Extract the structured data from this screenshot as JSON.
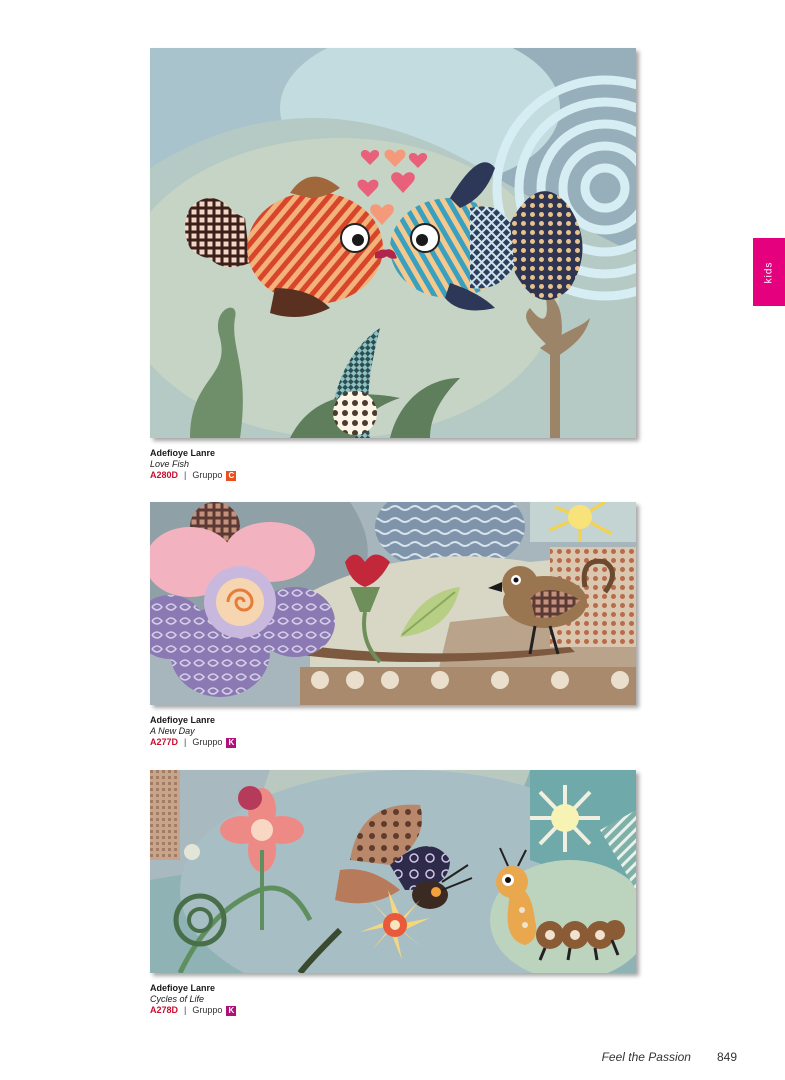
{
  "side_tab": {
    "label": "kids",
    "color": "#e5007e"
  },
  "products": [
    {
      "artist": "Adefioye Lanre",
      "title": "Love Fish",
      "code": "A280D",
      "group_label": "Gruppo",
      "group": "C",
      "group_color": "#e8501e"
    },
    {
      "artist": "Adefioye Lanre",
      "title": "A New Day",
      "code": "A277D",
      "group_label": "Gruppo",
      "group": "K",
      "group_color": "#b0107a"
    },
    {
      "artist": "Adefioye Lanre",
      "title": "Cycles of Life",
      "code": "A278D",
      "group_label": "Gruppo",
      "group": "K",
      "group_color": "#b0107a"
    }
  ],
  "footer": {
    "tagline": "Feel the Passion",
    "page_number": "849"
  },
  "colors": {
    "code_red": "#c8102e"
  }
}
